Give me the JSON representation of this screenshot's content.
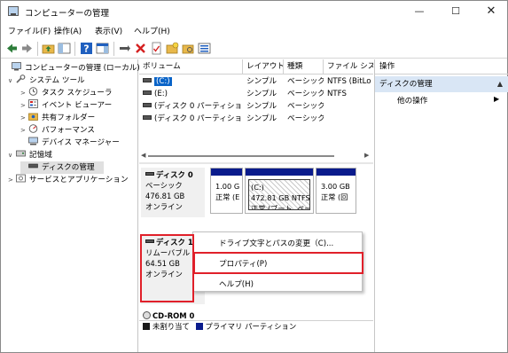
{
  "window": {
    "title": "コンピューターの管理",
    "controls": {
      "minimize": "—",
      "maximize": "☐",
      "close": "✕"
    }
  },
  "menu": [
    "ファイル(F)",
    "操作(A)",
    "表示(V)",
    "ヘルプ(H)"
  ],
  "tree": [
    {
      "label": "コンピューターの管理 (ローカル)",
      "icon": "computer-management-icon",
      "level": 0,
      "expander": ""
    },
    {
      "label": "システム ツール",
      "icon": "tools-icon",
      "level": 1,
      "expander": "∨"
    },
    {
      "label": "タスク スケジューラ",
      "icon": "clock-icon",
      "level": 2,
      "expander": ">"
    },
    {
      "label": "イベント ビューアー",
      "icon": "event-viewer-icon",
      "level": 2,
      "expander": ">"
    },
    {
      "label": "共有フォルダー",
      "icon": "shared-folder-icon",
      "level": 2,
      "expander": ">"
    },
    {
      "label": "パフォーマンス",
      "icon": "performance-icon",
      "level": 2,
      "expander": ">"
    },
    {
      "label": "デバイス マネージャー",
      "icon": "device-manager-icon",
      "level": 2,
      "expander": ""
    },
    {
      "label": "記憶域",
      "icon": "storage-icon",
      "level": 1,
      "expander": "∨"
    },
    {
      "label": "ディスクの管理",
      "icon": "disk-management-icon",
      "level": 2,
      "expander": "",
      "selected": true
    },
    {
      "label": "サービスとアプリケーション",
      "icon": "services-icon",
      "level": 1,
      "expander": ">"
    }
  ],
  "volume_list": {
    "columns": [
      "ボリューム",
      "レイアウト",
      "種類",
      "ファイル システム"
    ],
    "column_shown": [
      "ボリューム",
      "レイアウト",
      "種類",
      "ファイル シス"
    ],
    "rows": [
      {
        "volume": "(C:)",
        "layout": "シンプル",
        "type": "ベーシック",
        "fs": "NTFS (BitLo",
        "selected": true
      },
      {
        "volume": "(E:)",
        "layout": "シンプル",
        "type": "ベーシック",
        "fs": "NTFS"
      },
      {
        "volume": "(ディスク 0 パーティション 1)",
        "layout": "シンプル",
        "type": "ベーシック",
        "fs": ""
      },
      {
        "volume": "(ディスク 0 パーティション 4)",
        "layout": "シンプル",
        "type": "ベーシック",
        "fs": ""
      }
    ]
  },
  "disks": {
    "disk0": {
      "name": "ディスク 0",
      "type": "ベーシック",
      "size": "476.81 GB",
      "status": "オンライン",
      "partitions": [
        {
          "line1": "",
          "line2": "1.00 GB",
          "line3": "正常 (E"
        },
        {
          "line1": "(C:)",
          "line2": "472.81 GB NTFS",
          "line3": "正常 (ブート, ペー"
        },
        {
          "line1": "",
          "line2": "3.00 GB",
          "line3": "正常 (回"
        }
      ]
    },
    "disk1": {
      "name": "ディスク 1",
      "type": "リムーバブル",
      "size": "64.51 GB",
      "status": "オンライン"
    },
    "cdrom": {
      "name": "CD-ROM 0"
    }
  },
  "legend": [
    {
      "label": "未割り当て",
      "color": "#1a1a1a"
    },
    {
      "label": "プライマリ パーティション",
      "color": "#0a1b8c"
    }
  ],
  "context_menu": {
    "items": [
      "ドライブ文字とパスの変更（C)...",
      "プロパティ(P)",
      "ヘルプ(H)"
    ],
    "highlighted": "プロパティ(P)"
  },
  "actions": {
    "header": "操作",
    "section": "ディスクの管理",
    "item": "他の操作"
  },
  "colors": {
    "selection": "#0a64c8",
    "partition_bar": "#0a1b8c",
    "highlight_box": "#e0202a",
    "actions_section_bg": "#d9e6f5"
  }
}
